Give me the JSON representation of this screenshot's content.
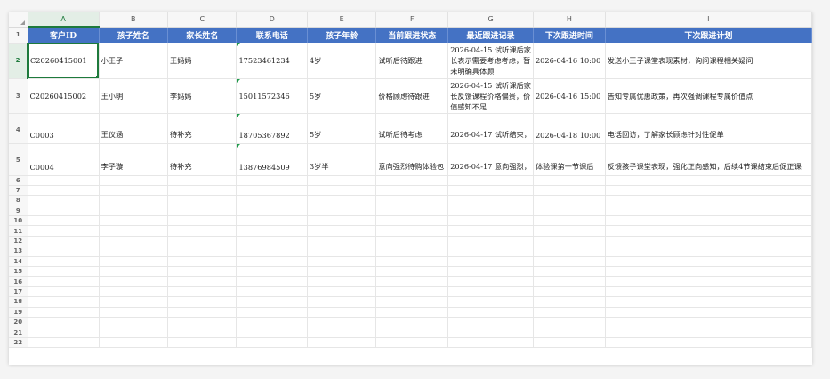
{
  "columns": [
    "A",
    "B",
    "C",
    "D",
    "E",
    "F",
    "G",
    "H",
    "I"
  ],
  "header_row": {
    "row_number": "1",
    "labels": [
      "客户ID",
      "孩子姓名",
      "家长姓名",
      "联系电话",
      "孩子年龄",
      "当前跟进状态",
      "最近跟进记录",
      "下次跟进时间",
      "下次跟进计划"
    ]
  },
  "rows": [
    {
      "row_number": "2",
      "cells": [
        "C20260415001",
        "小王子",
        "王妈妈",
        "17523461234",
        "4岁",
        "试听后待跟进",
        "2026-04-15 试听课后家长表示需要考虑考虑，暂未明确具体顾",
        "2026-04-16 10:00",
        "发送小王子课堂表现素材，询问课程相关疑问"
      ]
    },
    {
      "row_number": "3",
      "cells": [
        "C20260415002",
        "王小明",
        "李妈妈",
        "15011572346",
        "5岁",
        "价格顾虑待跟进",
        "2026-04-15 试听课后家长反馈课程价格偏贵，价值感知不足",
        "2026-04-16 15:00",
        "告知专属优惠政策，再次强调课程专属价值点"
      ]
    },
    {
      "row_number": "4",
      "cells": [
        "C0003",
        "王仪涵",
        "待补充",
        "18705367892",
        "5岁",
        "试听后待考虑",
        "2026-04-17 试听结束，",
        "2026-04-18 10:00",
        "电话回访，了解家长顾虑针对性促单"
      ]
    },
    {
      "row_number": "5",
      "cells": [
        "C0004",
        "李子璇",
        "待补充",
        "13876984509",
        "3岁半",
        "意向强烈待购体验包",
        "2026-04-17 意向强烈，",
        "体验课第一节课后",
        "反馈孩子课堂表现，强化正向感知，后续4节课结束后促正课"
      ]
    }
  ],
  "empty_rows": [
    "6",
    "7",
    "8",
    "9",
    "10",
    "11",
    "12",
    "13",
    "14",
    "15",
    "16",
    "17",
    "18",
    "19",
    "20",
    "21",
    "22"
  ],
  "colors": {
    "header_bg": "#4472c4",
    "selection": "#1e7a3c",
    "note_marker": "#1e9a4a"
  }
}
